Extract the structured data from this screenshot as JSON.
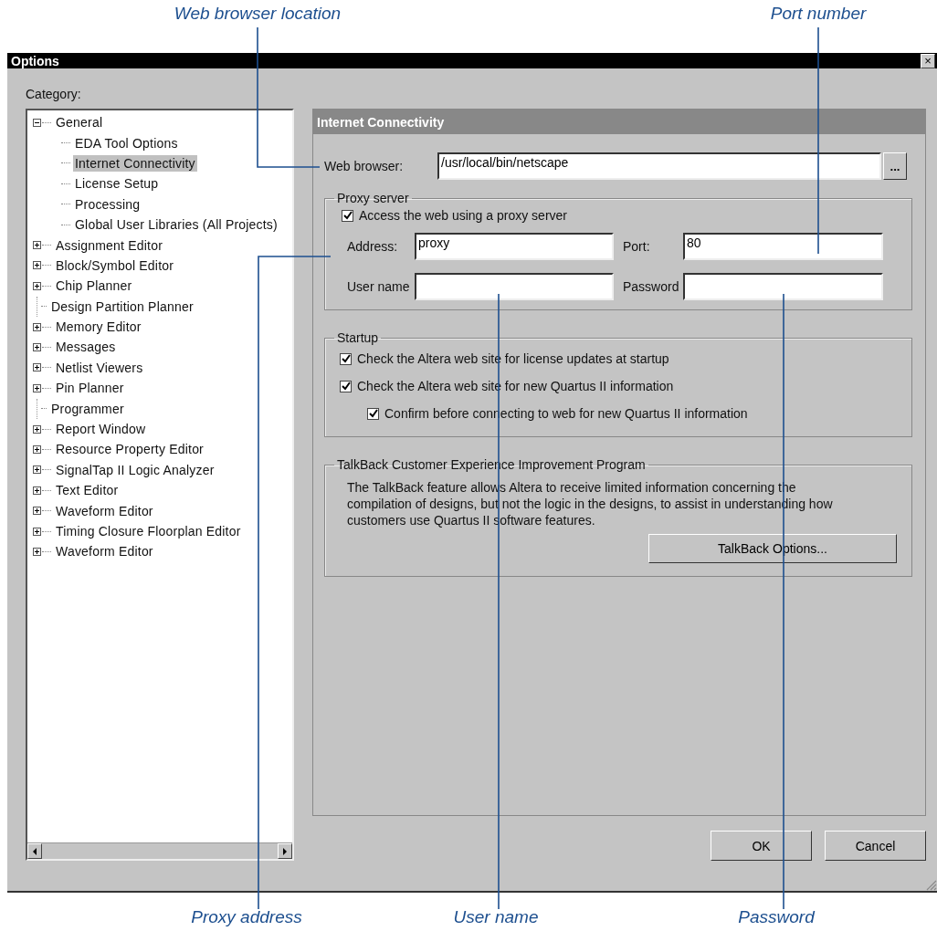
{
  "callouts_top": [
    {
      "label": "Web browser location"
    },
    {
      "label": "Port number"
    }
  ],
  "window": {
    "title": "Options",
    "close": "×"
  },
  "category_label": "Category:",
  "tree": [
    {
      "label": "General",
      "kind": "group",
      "expanded": true,
      "selected": false,
      "children": [
        {
          "label": "EDA Tool Options",
          "selected": false
        },
        {
          "label": "Internet Connectivity",
          "selected": true
        },
        {
          "label": "License Setup",
          "selected": false
        },
        {
          "label": "Processing",
          "selected": false
        },
        {
          "label": "Global User Libraries (All Projects)",
          "selected": false
        }
      ]
    },
    {
      "label": "Assignment Editor",
      "kind": "group",
      "expanded": false,
      "selected": false
    },
    {
      "label": "Block/Symbol Editor",
      "kind": "group",
      "expanded": false,
      "selected": false
    },
    {
      "label": "Chip Planner",
      "kind": "group",
      "expanded": false,
      "selected": false
    },
    {
      "label": "Design Partition Planner",
      "kind": "leaf",
      "selected": false
    },
    {
      "label": "Memory Editor",
      "kind": "group",
      "expanded": false,
      "selected": false
    },
    {
      "label": "Messages",
      "kind": "group",
      "expanded": false,
      "selected": false
    },
    {
      "label": "Netlist Viewers",
      "kind": "group",
      "expanded": false,
      "selected": false
    },
    {
      "label": "Pin Planner",
      "kind": "group",
      "expanded": false,
      "selected": false
    },
    {
      "label": "Programmer",
      "kind": "leaf",
      "selected": false
    },
    {
      "label": "Report Window",
      "kind": "group",
      "expanded": false,
      "selected": false
    },
    {
      "label": "Resource Property Editor",
      "kind": "group",
      "expanded": false,
      "selected": false
    },
    {
      "label": "SignalTap II Logic Analyzer",
      "kind": "group",
      "expanded": false,
      "selected": false
    },
    {
      "label": "Text Editor",
      "kind": "group",
      "expanded": false,
      "selected": false
    },
    {
      "label": "Waveform Editor",
      "kind": "group",
      "expanded": false,
      "selected": false
    },
    {
      "label": "Timing Closure Floorplan Editor",
      "kind": "group",
      "expanded": false,
      "selected": false
    },
    {
      "label": "Waveform Editor",
      "kind": "group",
      "expanded": false,
      "selected": false
    }
  ],
  "panel": {
    "title": "Internet Connectivity",
    "web_browser": {
      "label": "Web browser:",
      "value": "/usr/local/bin/netscape",
      "browse": "..."
    },
    "proxy_server": {
      "title": "Proxy server",
      "use_proxy": {
        "label": "Access the web using a proxy server",
        "checked": true
      },
      "address": {
        "label": "Address:",
        "value": "proxy"
      },
      "port": {
        "label": "Port:",
        "value": "80"
      },
      "user_name": {
        "label": "User name"
      },
      "password": {
        "label": "Password"
      }
    },
    "startup": {
      "title": "Startup",
      "options": [
        {
          "label": "Check the Altera web site for license updates at startup",
          "checked": true
        },
        {
          "label": "Check the Altera web site for new Quartus II information",
          "checked": true,
          "children": [
            {
              "label": "Confirm before connecting to web for new Quartus II information",
              "checked": true
            }
          ]
        }
      ]
    },
    "talkback": {
      "title": "TalkBack Customer Experience Improvement Program",
      "text": "The TalkBack feature allows Altera to receive limited information concerning the compilation of designs, but not the logic in the designs, to assist in understanding how customers use Quartus II software features.",
      "button": "TalkBack Options..."
    }
  },
  "buttons": [
    "OK",
    "Cancel"
  ],
  "callouts_bottom": [
    {
      "label": "Proxy address"
    },
    {
      "label": "User name"
    },
    {
      "label": "Password"
    }
  ]
}
